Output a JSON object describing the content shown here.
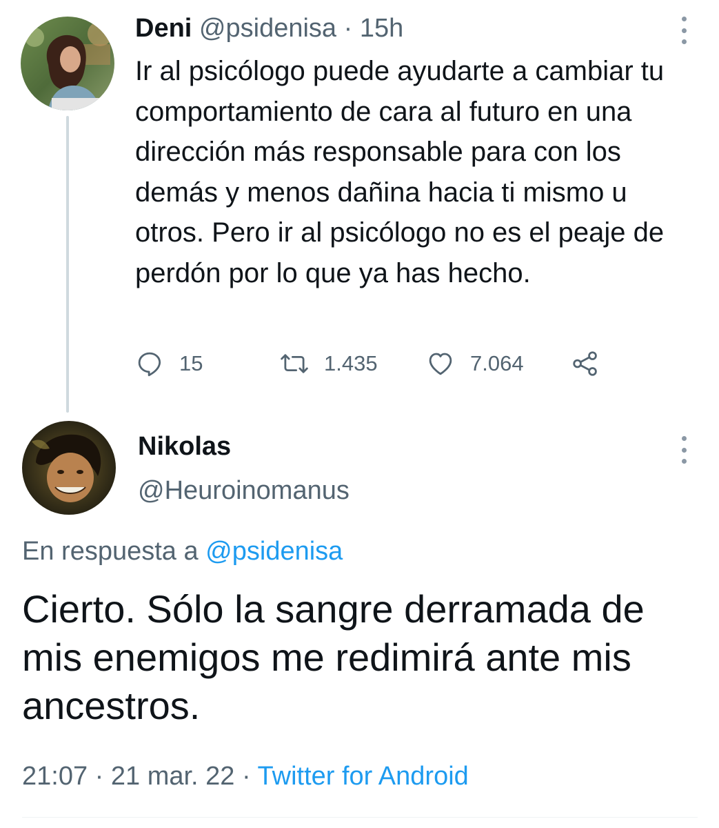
{
  "parent_tweet": {
    "display_name": "Deni",
    "handle": "@psidenisa",
    "separator": "·",
    "time": "15h",
    "text": "Ir al psicólogo puede ayudarte a cambiar tu comportamiento de cara al futuro en una dirección más responsable para con los demás y menos dañina hacia ti mismo u otros. Pero ir al psicólogo no es el peaje de perdón por lo que ya has hecho.",
    "replies": "15",
    "retweets": "1.435",
    "likes": "7.064",
    "icons": [
      "reply-icon",
      "retweet-icon",
      "like-icon",
      "share-icon",
      "more-icon"
    ]
  },
  "reply_tweet": {
    "display_name": "Nikolas",
    "handle": "@Heuroinomanus",
    "replying_prefix": "En respuesta a",
    "replying_to": "@psidenisa",
    "text": "Cierto. Sólo la sangre derramada de mis enemigos me redimirá ante mis ancestros.",
    "time": "21:07",
    "date": "21 mar. 22",
    "separator": "·",
    "source": "Twitter for Android"
  },
  "colors": {
    "text_primary": "#0f1419",
    "text_secondary": "#536471",
    "accent": "#1d9bf0",
    "thread_line": "#cfd9de"
  }
}
